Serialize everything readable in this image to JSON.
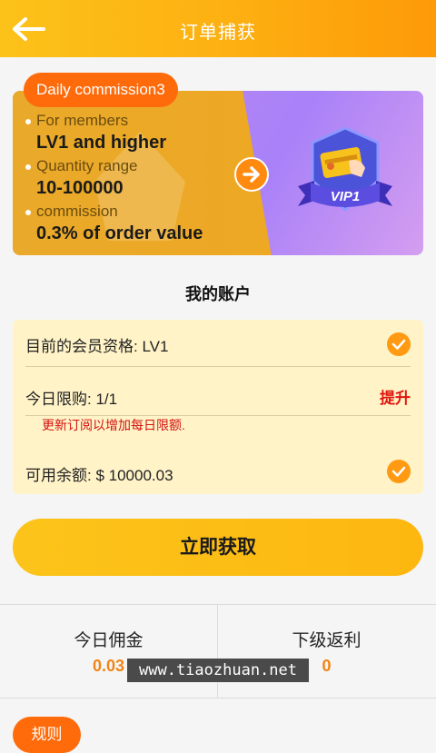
{
  "header": {
    "title": "订单捕获",
    "back_icon": "arrow-left-icon"
  },
  "promo": {
    "tag": "Daily commission3",
    "items": [
      {
        "label": "For members",
        "value": "LV1 and higher"
      },
      {
        "label": "Quantity range",
        "value": "10-100000"
      },
      {
        "label": "commission",
        "value": "0.3% of order value"
      }
    ],
    "arrow_icon": "arrow-right-icon",
    "badge_text": "VIP1",
    "badge_icon": "vip-card-badge-icon"
  },
  "account": {
    "title": "我的账户",
    "membership": "目前的会员资格: LV1",
    "daily_limit": "今日限购: 1/1",
    "upgrade": "提升",
    "hint": "更新订阅以增加每日限额.",
    "balance": "可用余额: $ 10000.03"
  },
  "action": {
    "grab_label": "立即获取"
  },
  "stats": {
    "today_commission_label": "今日佣金",
    "today_commission_value": "0.03",
    "sub_rebate_label": "下级返利",
    "sub_rebate_value": "0"
  },
  "watermark": "www.tiaozhuan.net",
  "rules": {
    "label": "规则"
  },
  "colors": {
    "accent": "#fdb112",
    "tag": "#ff6a0a",
    "warn": "#e0140e",
    "value": "#f08416"
  }
}
